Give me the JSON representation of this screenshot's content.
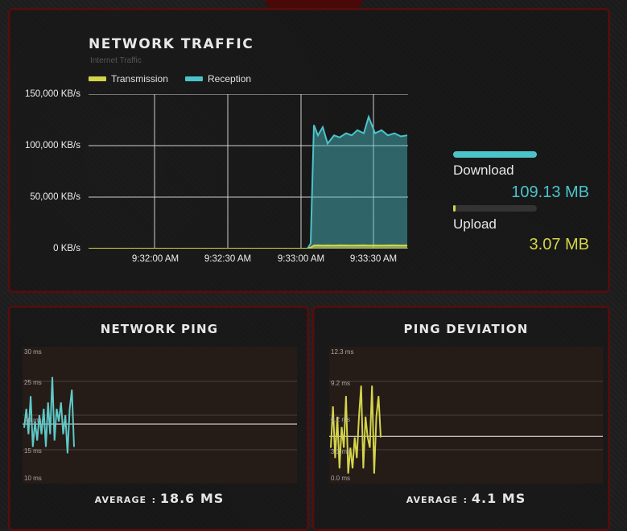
{
  "traffic": {
    "title": "Network Traffic",
    "subtitle": "Internet Traffic",
    "legend": {
      "transmission": "Transmission",
      "reception": "Reception"
    },
    "y_ticks": [
      "150,000 KB/s",
      "100,000 KB/s",
      "50,000 KB/s",
      "0 KB/s"
    ],
    "x_ticks": [
      "9:32:00 AM",
      "9:32:30 AM",
      "9:33:00 AM",
      "9:33:30 AM"
    ],
    "colors": {
      "transmission": "#d4d44a",
      "reception": "#4cc3c9"
    }
  },
  "stats": {
    "download": {
      "label": "Download",
      "value": "109.13 MB",
      "color": "#4cc3c9",
      "fill_fraction": 1.0
    },
    "upload": {
      "label": "Upload",
      "value": "3.07 MB",
      "color": "#d4d44a",
      "fill_fraction": 0.03
    }
  },
  "ping": {
    "title": "Network Ping",
    "y_ticks": [
      "30 ms",
      "25 ms",
      "20 ms",
      "15 ms",
      "10 ms"
    ],
    "average_label": "Average",
    "average_value": "18.6 ms",
    "color": "#5ec9c7"
  },
  "deviation": {
    "title": "Ping Deviation",
    "y_ticks": [
      "12.3 ms",
      "9.2 ms",
      "6.2 ms",
      "3.1 ms",
      "0.0 ms"
    ],
    "average_label": "Average",
    "average_value": "4.1 ms",
    "color": "#d4d44a"
  },
  "chart_data": [
    {
      "type": "area",
      "title": "Network Traffic",
      "ylabel": "",
      "xlabel": "",
      "ylim": [
        0,
        150000
      ],
      "x": [
        "9:31:45",
        "9:32:00",
        "9:32:15",
        "9:32:30",
        "9:32:45",
        "9:33:00",
        "9:33:02",
        "9:33:05",
        "9:33:07",
        "9:33:10",
        "9:33:12",
        "9:33:15",
        "9:33:17",
        "9:33:20",
        "9:33:22",
        "9:33:25",
        "9:33:27",
        "9:33:30",
        "9:33:32",
        "9:33:35",
        "9:33:37",
        "9:33:40",
        "9:33:42",
        "9:33:45"
      ],
      "series": [
        {
          "name": "Transmission",
          "values": [
            0,
            0,
            0,
            0,
            0,
            0,
            1000,
            3000,
            3200,
            3000,
            3100,
            3000,
            3200,
            3100,
            3000,
            3100,
            3200,
            3000,
            3100,
            3000,
            3100,
            3200,
            3000,
            3100
          ]
        },
        {
          "name": "Reception",
          "values": [
            0,
            0,
            0,
            0,
            0,
            0,
            5000,
            120000,
            110000,
            118000,
            102000,
            110000,
            108000,
            112000,
            110000,
            115000,
            112000,
            128000,
            112000,
            115000,
            110000,
            112000,
            109000,
            110000
          ]
        }
      ],
      "grid": true,
      "legend": "top-left"
    },
    {
      "type": "line",
      "title": "Network Ping",
      "ylim": [
        10,
        30
      ],
      "series": [
        {
          "name": "",
          "values": [
            18,
            21,
            17,
            23,
            15,
            19,
            16,
            20,
            17,
            21,
            15,
            22,
            17,
            26,
            16,
            21,
            19,
            22,
            17,
            20,
            14,
            21,
            24,
            15
          ]
        }
      ],
      "average": 18.6
    },
    {
      "type": "line",
      "title": "Ping Deviation",
      "ylim": [
        0,
        12.3
      ],
      "series": [
        {
          "name": "",
          "values": [
            3,
            7,
            2,
            6,
            1,
            5,
            3,
            8,
            0.5,
            3,
            1,
            4,
            2,
            6,
            9,
            1,
            6,
            4,
            3,
            9,
            0.5,
            6,
            8,
            4
          ]
        }
      ],
      "average": 4.1
    }
  ]
}
